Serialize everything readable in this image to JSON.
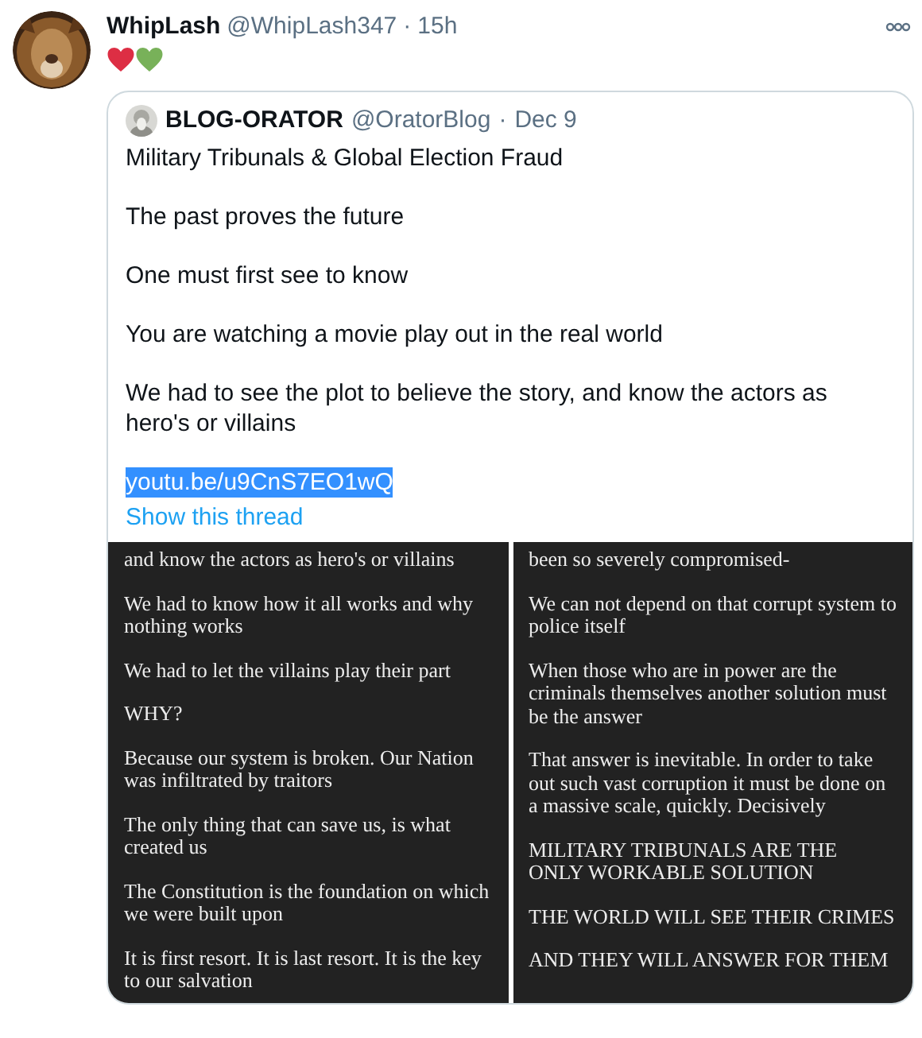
{
  "tweet": {
    "name": "WhipLash",
    "handle": "@WhipLash347",
    "separator": "·",
    "time": "15h",
    "emoji_hearts": [
      {
        "color": "#dd2e44"
      },
      {
        "color": "#78b159"
      }
    ],
    "quote": {
      "name": "BLOG-ORATOR",
      "handle": "@OratorBlog",
      "separator": "·",
      "date": "Dec 9",
      "paragraphs": [
        "Military Tribunals & Global Election Fraud",
        "The past proves the future",
        "One must first see to know",
        "You are watching a movie play out in the real world",
        "We had to see the plot to believe the story, and know the actors as hero's or villains"
      ],
      "link": {
        "text": "youtu.be/u9CnS7EO1wQ",
        "selected": true
      },
      "show_thread": "Show this thread",
      "images": [
        {
          "paragraphs": [
            "and know the actors as hero's or villains",
            "We had to know how it all works and why nothing works",
            "We had to let the villains play their part",
            "WHY?",
            "Because our system is broken. Our Nation was infiltrated by traitors",
            "The only thing that can save us, is what created us",
            "The Constitution is the foundation on which we were built upon",
            "It is first resort. It is last resort. It is the key to our salvation"
          ]
        },
        {
          "paragraphs": [
            "been so severely compromised-",
            "We can not depend on that corrupt system to police itself",
            "When those who are in power are the criminals themselves another solution must be the answer",
            "That answer is inevitable. In order to take out such vast corruption it must be done on a massive scale, quickly. Decisively",
            "MILITARY TRIBUNALS ARE THE ONLY WORKABLE SOLUTION",
            "THE WORLD WILL SEE THEIR CRIMES",
            "AND THEY WILL ANSWER FOR THEM"
          ]
        }
      ]
    }
  }
}
